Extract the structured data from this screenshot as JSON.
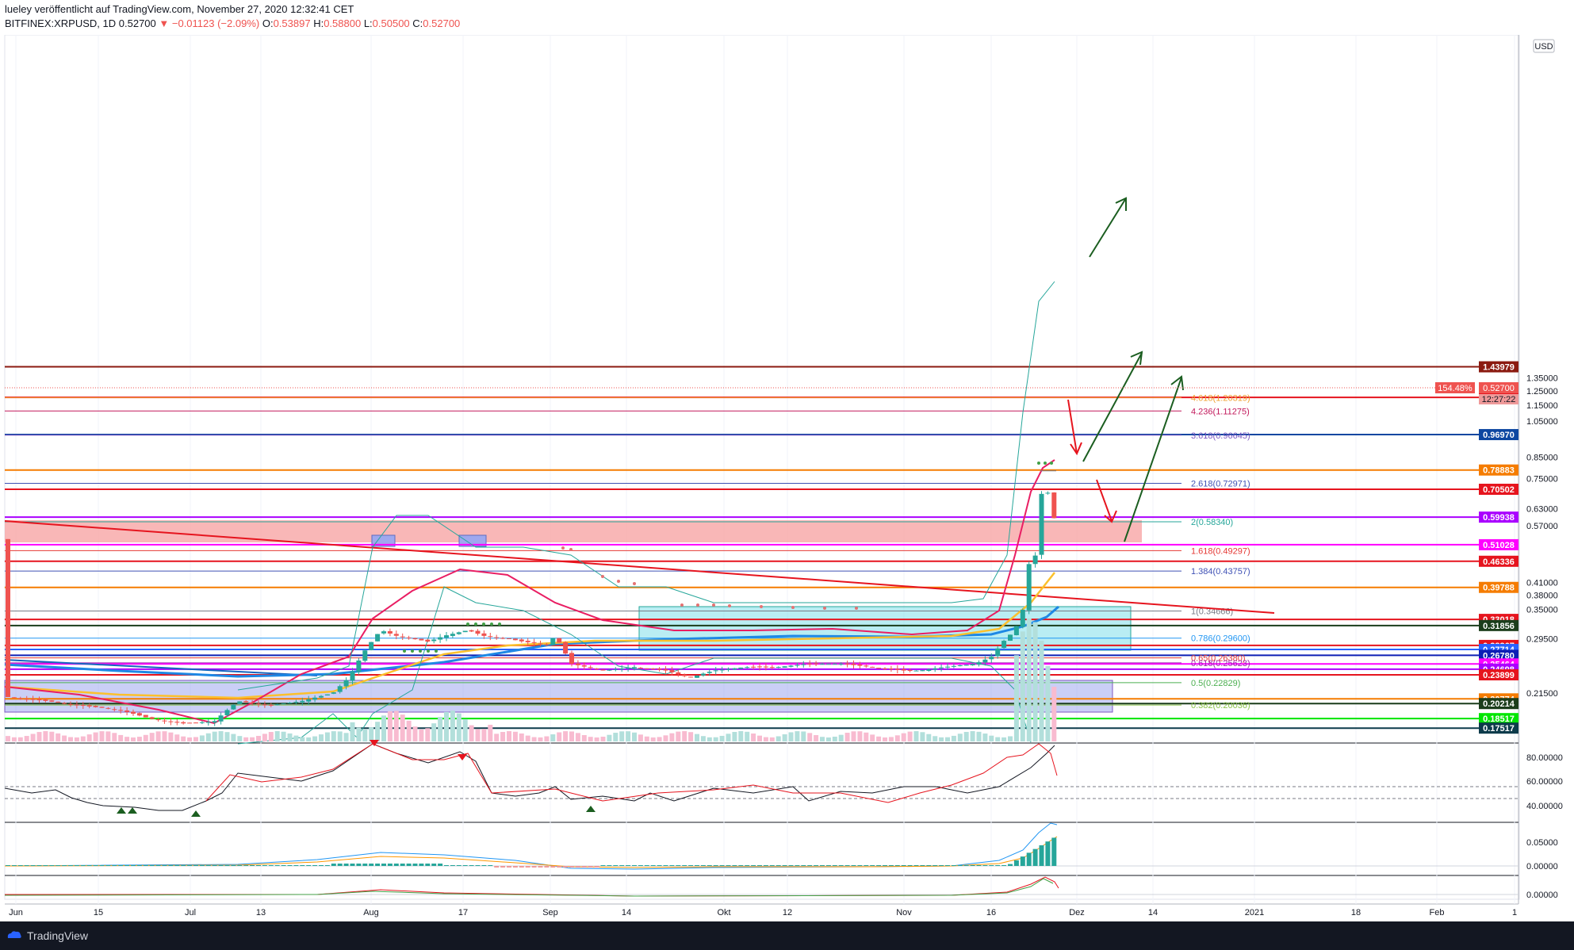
{
  "header": {
    "line1": "lueley veröffentlicht auf TradingView.com, November 27, 2020 12:32:41 CET",
    "symbol": "BITFINEX:XRPUSD, 1D",
    "last": "0.52700",
    "change": "▼ −0.01123 (−2.09%)",
    "o_label": "O:",
    "o": "0.53897",
    "h_label": "H:",
    "h": "0.58800",
    "l_label": "L:",
    "l": "0.50500",
    "c_label": "C:",
    "c": "0.52700"
  },
  "footer": {
    "brand": "TradingView"
  },
  "currency_button": "USD",
  "chart_data": {
    "type": "candlestick",
    "symbol": "BITFINEX:XRPUSD",
    "interval": "1D",
    "y_scale": "log",
    "x_tick_labels": [
      "Jun",
      "15",
      "Jul",
      "13",
      "Aug",
      "17",
      "Sep",
      "14",
      "Okt",
      "12",
      "Nov",
      "16",
      "Dez",
      "14",
      "2021",
      "18",
      "Feb",
      "1"
    ],
    "price_ticks": [
      "1.35000",
      "1.25000",
      "1.15000",
      "1.05000",
      "0.85000",
      "0.75000",
      "0.63000",
      "0.57000",
      "0.41000",
      "0.38000",
      "0.35000",
      "0.29500",
      "0.21500"
    ],
    "last_price_label": "0.52700",
    "last_change_pct": "154.48%",
    "countdown": "12:27:22",
    "horizontal_levels": [
      {
        "price": 1.43979,
        "label": "1.43979",
        "color": "#8b1a10"
      },
      {
        "price": 1.20471,
        "label": "1.20471",
        "color": "#e6141e"
      },
      {
        "price": 0.9697,
        "label": "0.96970",
        "color": "#0d47a1"
      },
      {
        "price": 0.78883,
        "label": "0.78883",
        "color": "#f57c00"
      },
      {
        "price": 0.70502,
        "label": "0.70502",
        "color": "#e6141e"
      },
      {
        "price": 0.59938,
        "label": "0.59938",
        "color": "#aa00ff"
      },
      {
        "price": 0.51028,
        "label": "0.51028",
        "color": "#ff00ff"
      },
      {
        "price": 0.46336,
        "label": "0.46336",
        "color": "#e6141e"
      },
      {
        "price": 0.39788,
        "label": "0.39788",
        "color": "#f57c00"
      },
      {
        "price": 0.33018,
        "label": "0.33018",
        "color": "#e6141e"
      },
      {
        "price": 0.31856,
        "label": "0.31856",
        "color": "#1b3d1b"
      },
      {
        "price": 0.28367,
        "label": "0.28367",
        "color": "#e6141e"
      },
      {
        "price": 0.27714,
        "label": "0.27714",
        "color": "#2962ff"
      },
      {
        "price": 0.2678,
        "label": "0.26780",
        "color": "#0d1fb5"
      },
      {
        "price": 0.25464,
        "label": "0.25464",
        "color": "#ff00ff"
      },
      {
        "price": 0.24698,
        "label": "0.24698",
        "color": "#aa00ff"
      },
      {
        "price": 0.23899,
        "label": "0.23899",
        "color": "#e6141e"
      },
      {
        "price": 0.20774,
        "label": "0.20774",
        "color": "#f57c00"
      },
      {
        "price": 0.20214,
        "label": "0.20214",
        "color": "#1b3d1b"
      },
      {
        "price": 0.18517,
        "label": "0.18517",
        "color": "#00e600"
      },
      {
        "price": 0.17517,
        "label": "0.17517",
        "color": "#0d3b4b"
      }
    ],
    "fib_levels": [
      {
        "label": "4.618(1.20319)",
        "price": 1.20319,
        "color": "#f0a030"
      },
      {
        "label": "4.236(1.11275)",
        "price": 1.11275,
        "color": "#c2185b"
      },
      {
        "label": "3.618(0.96645)",
        "price": 0.96645,
        "color": "#7e57c2"
      },
      {
        "label": "2.618(0.72971)",
        "price": 0.72971,
        "color": "#3f51b5"
      },
      {
        "label": "2(0.58340)",
        "price": 0.5834,
        "color": "#26a69a"
      },
      {
        "label": "1.618(0.49297)",
        "price": 0.49297,
        "color": "#e53935"
      },
      {
        "label": "1.384(0.43757)",
        "price": 0.43757,
        "color": "#3f51b5"
      },
      {
        "label": "1(0.34666)",
        "price": 0.34666,
        "color": "#787b86"
      },
      {
        "label": "0.786(0.29600)",
        "price": 0.296,
        "color": "#2196f3"
      },
      {
        "label": "0.65(0.26380)",
        "price": 0.2638,
        "color": "#e53935"
      },
      {
        "label": "0.618(0.25623)",
        "price": 0.25623,
        "color": "#9c27b0"
      },
      {
        "label": "0.5(0.22829)",
        "price": 0.22829,
        "color": "#4caf50"
      },
      {
        "label": "0.382(0.20036)",
        "price": 0.20036,
        "color": "#8bc34a"
      }
    ],
    "rsi_ticks": [
      "80.00000",
      "60.00000",
      "40.00000"
    ],
    "macd_ticks": [
      "0.05000",
      "0.00000"
    ],
    "osc_ticks": [
      "0.00000"
    ]
  }
}
